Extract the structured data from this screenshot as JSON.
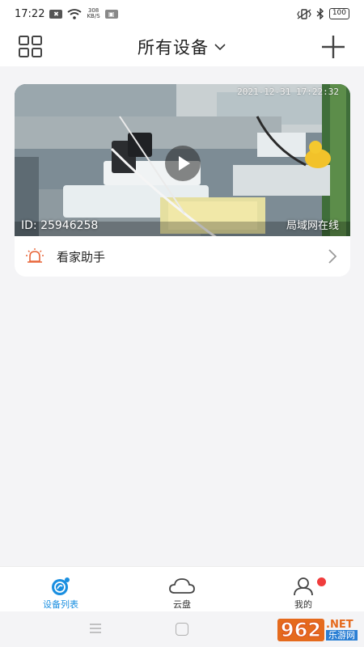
{
  "status_bar": {
    "time": "17:22",
    "net_speed_top": "308",
    "net_speed_bottom": "KB/S",
    "battery": "100"
  },
  "header": {
    "title": "所有设备"
  },
  "device": {
    "timestamp": "2021-12-31  17:22:32",
    "id_text": "ID: 25946258",
    "status_text": "局域网在线",
    "assistant_label": "看家助手"
  },
  "bottom_nav": {
    "items": [
      {
        "label": "设备列表",
        "icon": "camera-icon",
        "active": true
      },
      {
        "label": "云盘",
        "icon": "cloud-icon",
        "active": false
      },
      {
        "label": "我的",
        "icon": "user-icon",
        "active": false
      }
    ]
  },
  "watermark": {
    "number": "962",
    "suffix": ".NET",
    "site_cn": "乐游网"
  },
  "colors": {
    "accent": "#1a8fe0",
    "alert": "#e8663a",
    "badge": "#f03c3c"
  }
}
